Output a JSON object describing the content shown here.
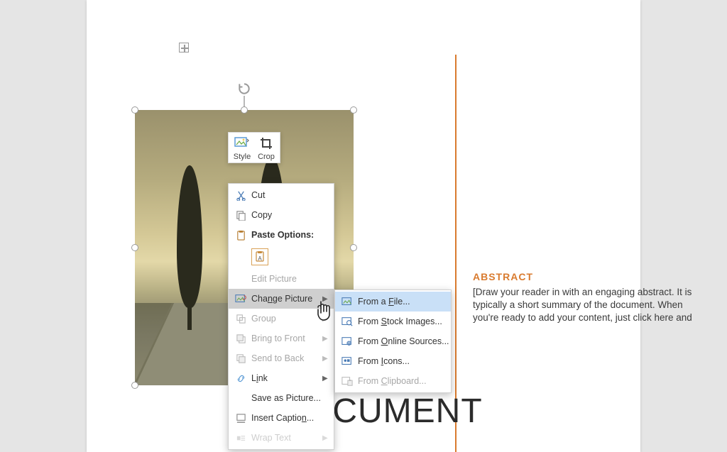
{
  "page": {
    "document_title_fragment": "[DOCUMENT",
    "abstract_heading": "ABSTRACT",
    "abstract_body": "[Draw your reader in with an engaging abstract. It is typically a short summary of the document. When you're ready to add your content, just click here and"
  },
  "mini_toolbar": {
    "style_label": "Style",
    "crop_label": "Crop"
  },
  "context_menu": {
    "cut": "Cut",
    "copy": "Copy",
    "paste_options": "Paste Options:",
    "edit_picture": "Edit Picture",
    "change_picture": "Change Picture",
    "group": "Group",
    "bring_front": "Bring to Front",
    "send_back": "Send to Back",
    "link": "Link",
    "save_as_picture": "Save as Picture...",
    "insert_caption": "Insert Caption...",
    "wrap_text": "Wrap Text"
  },
  "change_picture_submenu": {
    "from_file": "From a File...",
    "from_stock": "From Stock Images...",
    "from_online": "From Online Sources...",
    "from_icons": "From Icons...",
    "from_clipboard": "From Clipboard..."
  }
}
